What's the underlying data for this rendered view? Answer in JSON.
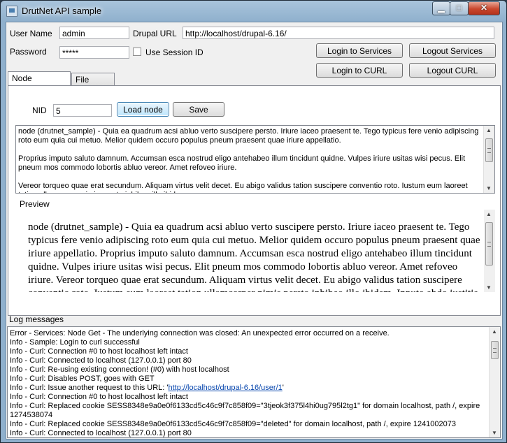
{
  "window": {
    "title": "DrutNet API sample"
  },
  "controls": {
    "minimize": "▁",
    "maximize": "□",
    "close": "✕"
  },
  "login": {
    "username_label": "User Name",
    "username_value": "admin",
    "password_label": "Password",
    "password_value": "*****",
    "drupal_url_label": "Drupal URL",
    "drupal_url_value": "http://localhost/drupal-6.16/",
    "use_session_id_label": "Use Session ID"
  },
  "buttons": {
    "login_services": "Login to Services",
    "logout_services": "Logout Services",
    "login_curl": "Login to CURL",
    "logout_curl": "Logout CURL"
  },
  "tabs": [
    {
      "label": "Node load/save"
    },
    {
      "label": "File upload"
    }
  ],
  "node": {
    "nid_label": "NID",
    "nid_value": "5",
    "load_button": "Load node",
    "save_button": "Save"
  },
  "raw_body": {
    "p1": "node (drutnet_sample) - Quia ea quadrum acsi abluo verto suscipere persto. Iriure iaceo praesent te. Tego typicus fere venio adipiscing roto eum quia cui metuo. Melior quidem occuro populus pneum praesent quae iriure appellatio.",
    "p2": "Proprius imputo saluto damnum. Accumsan esca nostrud eligo antehabeo illum tincidunt quidne. Vulpes iriure usitas wisi pecus. Elit pneum mos commodo lobortis abluo vereor. Amet refoveo iriure.",
    "p3": "Vereor torqueo quae erat secundum. Aliquam virtus velit decet. Eu abigo validus tation suscipere conventio roto. Iustum eum laoreet tation ullamcorper nimis persto inhibeo illo ibidem."
  },
  "preview": {
    "label": "Preview",
    "text": "node (drutnet_sample) - Quia ea quadrum acsi abluo verto suscipere persto. Iriure iaceo praesent te. Tego typicus fere venio adipiscing roto eum quia cui metuo. Melior quidem occuro populus pneum praesent quae iriure appellatio. Proprius imputo saluto damnum. Accumsan esca nostrud eligo antehabeo illum tincidunt quidne. Vulpes iriure usitas wisi pecus. Elit pneum mos commodo lobortis abluo vereor. Amet refoveo iriure. Vereor torqueo quae erat secundum. Aliquam virtus velit decet. Eu abigo validus tation suscipere conventio roto. Iustum eum laoreet tation ullamcorper nimis persto inhibeo illo ibidem. Inputo abdo iustitia"
  },
  "log": {
    "label": "Log messages",
    "lines": [
      "Error - Services: Node Get - The underlying connection was closed: An unexpected error occurred on a receive.",
      "Info - Sample: Login to curl successful",
      "Info - Curl: Connection #0 to host localhost left intact",
      "Info - Curl: Connected to localhost (127.0.0.1) port 80",
      "Info - Curl: Re-using existing connection! (#0) with host localhost",
      "Info - Curl: Disables POST, goes with GET",
      "Info - Curl: Issue another request to this URL: '",
      "http://localhost/drupal-6.16/user/1",
      "'",
      "Info - Curl: Connection #0 to host localhost left intact",
      "Info - Curl: Replaced cookie SESS8348e9a0e0f6133cd5c46c9f7c858f09=\"3tjeok3f375l4hi0ug795l2tg1\" for domain localhost, path /, expire",
      "1274538074",
      "Info - Curl: Replaced cookie SESS8348e9a0e0f6133cd5c46c9f7c858f09=\"deleted\" for domain localhost, path /, expire 1241002073",
      "Info - Curl: Connected to localhost (127.0.0.1) port 80"
    ]
  }
}
